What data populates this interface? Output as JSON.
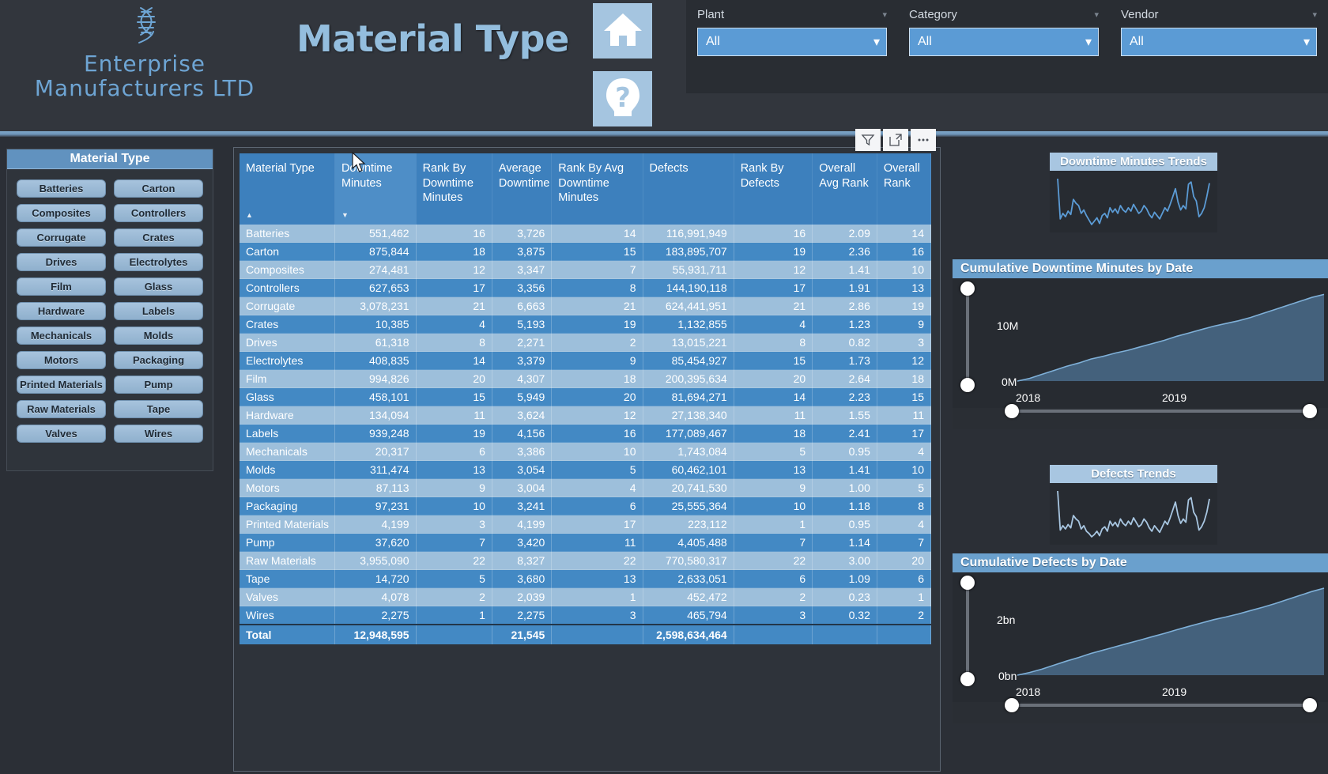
{
  "header": {
    "logo_line1": "Enterprise",
    "logo_line2": "Manufacturers LTD",
    "logo_icon": "dna-icon",
    "page_title": "Material Type",
    "nav": [
      {
        "name": "home-button",
        "icon": "home-icon"
      },
      {
        "name": "help-button",
        "icon": "question-mark-icon"
      }
    ],
    "slicers": [
      {
        "label": "Plant",
        "value": "All",
        "icon": "chevron-down-icon"
      },
      {
        "label": "Category",
        "value": "All",
        "icon": "chevron-down-icon"
      },
      {
        "label": "Vendor",
        "value": "All",
        "icon": "chevron-down-icon"
      }
    ]
  },
  "material_slicer": {
    "title": "Material Type",
    "items": [
      "Batteries",
      "Carton",
      "Composites",
      "Controllers",
      "Corrugate",
      "Crates",
      "Drives",
      "Electrolytes",
      "Film",
      "Glass",
      "Hardware",
      "Labels",
      "Mechanicals",
      "Molds",
      "Motors",
      "Packaging",
      "Printed Materials",
      "Pump",
      "Raw Materials",
      "Tape",
      "Valves",
      "Wires"
    ]
  },
  "visual_toolbar": [
    {
      "name": "filter-icon",
      "label": "Filter"
    },
    {
      "name": "focus-mode-icon",
      "label": "Focus mode"
    },
    {
      "name": "more-options-icon",
      "label": "More options"
    }
  ],
  "table": {
    "columns": [
      "Material Type",
      "Downtime Minutes",
      "Rank By Downtime Minutes",
      "Average Downtime",
      "Rank By Avg Downtime Minutes",
      "Defects",
      "Rank By Defects",
      "Overall Avg Rank",
      "Overall Rank"
    ],
    "sort_column": "Downtime Minutes",
    "sort_indicator_material": "ascending",
    "sort_indicator_downtime": "descending",
    "rows": [
      [
        "Batteries",
        "551,462",
        "16",
        "3,726",
        "14",
        "116,991,949",
        "16",
        "2.09",
        "14"
      ],
      [
        "Carton",
        "875,844",
        "18",
        "3,875",
        "15",
        "183,895,707",
        "19",
        "2.36",
        "16"
      ],
      [
        "Composites",
        "274,481",
        "12",
        "3,347",
        "7",
        "55,931,711",
        "12",
        "1.41",
        "10"
      ],
      [
        "Controllers",
        "627,653",
        "17",
        "3,356",
        "8",
        "144,190,118",
        "17",
        "1.91",
        "13"
      ],
      [
        "Corrugate",
        "3,078,231",
        "21",
        "6,663",
        "21",
        "624,441,951",
        "21",
        "2.86",
        "19"
      ],
      [
        "Crates",
        "10,385",
        "4",
        "5,193",
        "19",
        "1,132,855",
        "4",
        "1.23",
        "9"
      ],
      [
        "Drives",
        "61,318",
        "8",
        "2,271",
        "2",
        "13,015,221",
        "8",
        "0.82",
        "3"
      ],
      [
        "Electrolytes",
        "408,835",
        "14",
        "3,379",
        "9",
        "85,454,927",
        "15",
        "1.73",
        "12"
      ],
      [
        "Film",
        "994,826",
        "20",
        "4,307",
        "18",
        "200,395,634",
        "20",
        "2.64",
        "18"
      ],
      [
        "Glass",
        "458,101",
        "15",
        "5,949",
        "20",
        "81,694,271",
        "14",
        "2.23",
        "15"
      ],
      [
        "Hardware",
        "134,094",
        "11",
        "3,624",
        "12",
        "27,138,340",
        "11",
        "1.55",
        "11"
      ],
      [
        "Labels",
        "939,248",
        "19",
        "4,156",
        "16",
        "177,089,467",
        "18",
        "2.41",
        "17"
      ],
      [
        "Mechanicals",
        "20,317",
        "6",
        "3,386",
        "10",
        "1,743,084",
        "5",
        "0.95",
        "4"
      ],
      [
        "Molds",
        "311,474",
        "13",
        "3,054",
        "5",
        "60,462,101",
        "13",
        "1.41",
        "10"
      ],
      [
        "Motors",
        "87,113",
        "9",
        "3,004",
        "4",
        "20,741,530",
        "9",
        "1.00",
        "5"
      ],
      [
        "Packaging",
        "97,231",
        "10",
        "3,241",
        "6",
        "25,555,364",
        "10",
        "1.18",
        "8"
      ],
      [
        "Printed Materials",
        "4,199",
        "3",
        "4,199",
        "17",
        "223,112",
        "1",
        "0.95",
        "4"
      ],
      [
        "Pump",
        "37,620",
        "7",
        "3,420",
        "11",
        "4,405,488",
        "7",
        "1.14",
        "7"
      ],
      [
        "Raw Materials",
        "3,955,090",
        "22",
        "8,327",
        "22",
        "770,580,317",
        "22",
        "3.00",
        "20"
      ],
      [
        "Tape",
        "14,720",
        "5",
        "3,680",
        "13",
        "2,633,051",
        "6",
        "1.09",
        "6"
      ],
      [
        "Valves",
        "4,078",
        "2",
        "2,039",
        "1",
        "452,472",
        "2",
        "0.23",
        "1"
      ],
      [
        "Wires",
        "2,275",
        "1",
        "2,275",
        "3",
        "465,794",
        "3",
        "0.32",
        "2"
      ]
    ],
    "total_row": [
      "Total",
      "12,948,595",
      "",
      "21,545",
      "",
      "2,598,634,464",
      "",
      "",
      ""
    ]
  },
  "right_panel": {
    "downtime_trend": {
      "title": "Downtime Minutes Trends"
    },
    "defects_trend": {
      "title": "Defects Trends"
    },
    "cumulative_downtime": {
      "title": "Cumulative Downtime Minutes by Date",
      "y_ticks": [
        "10M",
        "0M"
      ],
      "x_ticks": [
        "2018",
        "2019"
      ]
    },
    "cumulative_defects": {
      "title": "Cumulative Defects by Date",
      "y_ticks": [
        "2bn",
        "0bn"
      ],
      "x_ticks": [
        "2018",
        "2019"
      ]
    }
  },
  "chart_data": [
    {
      "type": "line",
      "title": "Downtime Minutes Trends",
      "xlabel": "",
      "ylabel": "",
      "grid": false,
      "legend": null,
      "values": [
        92,
        20,
        30,
        24,
        34,
        28,
        55,
        48,
        44,
        30,
        36,
        26,
        18,
        10,
        16,
        22,
        12,
        26,
        30,
        22,
        40,
        32,
        38,
        30,
        44,
        36,
        32,
        40,
        34,
        46,
        38,
        30,
        34,
        44,
        38,
        28,
        22,
        32,
        26,
        20,
        30,
        40,
        34,
        46,
        60,
        74,
        50,
        36,
        44,
        38,
        82,
        86,
        60,
        52,
        24,
        30,
        40,
        60,
        84
      ]
    },
    {
      "type": "line",
      "title": "Defects Trends",
      "xlabel": "",
      "ylabel": "",
      "grid": false,
      "legend": null,
      "values": [
        96,
        26,
        34,
        28,
        36,
        30,
        52,
        46,
        42,
        28,
        34,
        24,
        20,
        14,
        18,
        24,
        16,
        28,
        32,
        24,
        42,
        34,
        40,
        32,
        46,
        38,
        34,
        42,
        36,
        48,
        40,
        32,
        36,
        46,
        40,
        30,
        24,
        34,
        28,
        22,
        32,
        42,
        36,
        48,
        62,
        76,
        52,
        38,
        46,
        40,
        80,
        84,
        58,
        50,
        26,
        32,
        42,
        58,
        82
      ]
    },
    {
      "type": "area",
      "title": "Cumulative Downtime Minutes by Date",
      "xlabel": "",
      "ylabel": "",
      "ylim": [
        0,
        13000000
      ],
      "y_ticks": [
        0,
        10000000
      ],
      "y_tick_labels": [
        "0M",
        "10M"
      ],
      "x_ticks": [
        "2018",
        "2019"
      ],
      "grid": false,
      "values": [
        0,
        0.4,
        1.0,
        1.6,
        2.2,
        2.7,
        3.3,
        3.7,
        4.2,
        4.6,
        5.1,
        5.6,
        6.1,
        6.7,
        7.2,
        7.7,
        8.2,
        8.6,
        9.0,
        9.5,
        10.1,
        10.7,
        11.3,
        11.9,
        12.5,
        12.95
      ],
      "value_unit": "millions of minutes"
    },
    {
      "type": "area",
      "title": "Cumulative Defects by Date",
      "xlabel": "",
      "ylabel": "",
      "ylim": [
        0,
        2.6
      ],
      "y_ticks": [
        0,
        2
      ],
      "y_tick_labels": [
        "0bn",
        "2bn"
      ],
      "x_ticks": [
        "2018",
        "2019"
      ],
      "grid": false,
      "values": [
        0,
        0.08,
        0.18,
        0.3,
        0.42,
        0.53,
        0.65,
        0.75,
        0.85,
        0.95,
        1.05,
        1.15,
        1.25,
        1.36,
        1.46,
        1.56,
        1.66,
        1.74,
        1.83,
        1.93,
        2.03,
        2.14,
        2.26,
        2.38,
        2.5,
        2.6
      ],
      "value_unit": "billions of defects"
    }
  ],
  "colors": {
    "accent_blue": "#5b9bd5",
    "header_blue": "#3d80bd",
    "row_odd": "#4389c4",
    "row_even": "#9dbfdb",
    "panel_bg": "#2e333a",
    "page_bg": "#2b2f36",
    "chip": "#a7c3dd",
    "title_text": "#94bede"
  }
}
